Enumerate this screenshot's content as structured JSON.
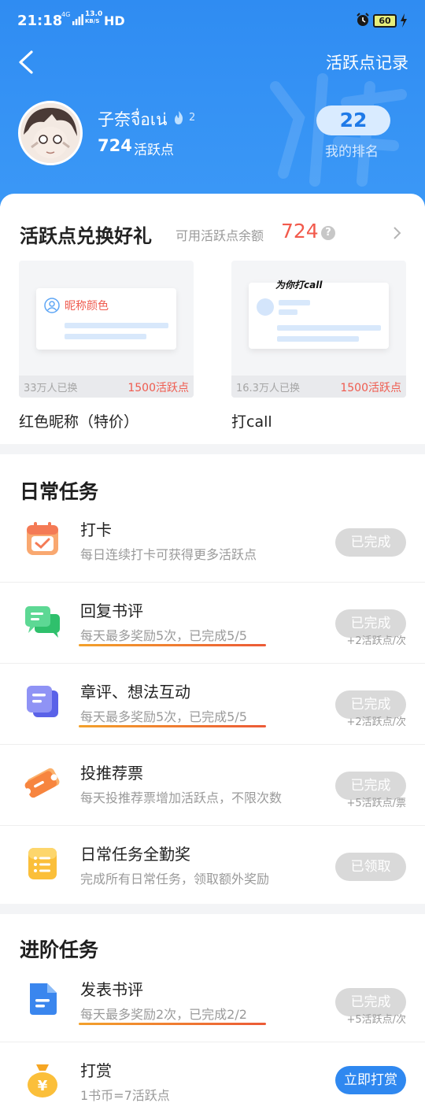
{
  "status_bar": {
    "time": "21:18",
    "network": "4G",
    "speed": "13.0",
    "speed_unit": "KB/S",
    "hd": "HD",
    "battery": "60"
  },
  "header": {
    "record_link": "活跃点记录",
    "nickname": "子奈จื่อเน่",
    "level": "2",
    "points": "724",
    "points_unit": "活跃点",
    "rank": "22",
    "rank_label": "我的排名"
  },
  "gifts": {
    "title": "活跃点兑换好礼",
    "balance_label": "可用活跃点余额",
    "balance": "724",
    "help": "?",
    "items": [
      {
        "name": "红色昵称（特价）",
        "count": "33万人已换",
        "cost": "1500活跃点",
        "preview_text": "昵称颜色"
      },
      {
        "name": "打call",
        "count": "16.3万人已换",
        "cost": "1500活跃点",
        "preview_text": "为你打call"
      }
    ]
  },
  "daily": {
    "title": "日常任务",
    "tasks": [
      {
        "name": "打卡",
        "desc": "每日连续打卡可获得更多活跃点",
        "button": "已完成",
        "reward": ""
      },
      {
        "name": "回复书评",
        "desc": "每天最多奖励5次，已完成5/5",
        "button": "已完成",
        "reward": "+2活跃点/次"
      },
      {
        "name": "章评、想法互动",
        "desc": "每天最多奖励5次，已完成5/5",
        "button": "已完成",
        "reward": "+2活跃点/次"
      },
      {
        "name": "投推荐票",
        "desc": "每天投推荐票增加活跃点，不限次数",
        "button": "已完成",
        "reward": "+5活跃点/票"
      },
      {
        "name": "日常任务全勤奖",
        "desc": "完成所有日常任务，领取额外奖励",
        "button": "已领取",
        "reward": ""
      }
    ]
  },
  "advanced": {
    "title": "进阶任务",
    "tasks": [
      {
        "name": "发表书评",
        "desc": "每天最多奖励2次，已完成2/2",
        "button": "已完成",
        "reward": "+5活跃点/次"
      },
      {
        "name": "打赏",
        "desc": "1书币=7活跃点",
        "button": "立即打赏",
        "reward": ""
      }
    ]
  },
  "colors": {
    "header_blue": "#3b98f6",
    "accent_red": "#f25a4c",
    "button_gray": "#d9d9d9",
    "button_blue": "#2f88f0"
  }
}
